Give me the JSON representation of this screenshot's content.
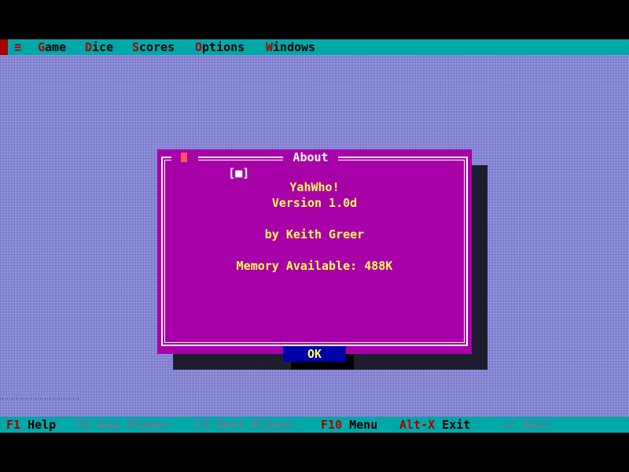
{
  "menubar": {
    "system_icon": "≡",
    "items": [
      {
        "hot": "G",
        "rest": "ame"
      },
      {
        "hot": "D",
        "rest": "ice"
      },
      {
        "hot": "S",
        "rest": "cores"
      },
      {
        "hot": "O",
        "rest": "ptions"
      },
      {
        "hot": "W",
        "rest": "indows"
      }
    ]
  },
  "dialog": {
    "title": "About",
    "close_box": "[■]",
    "app_name": "YahWho!",
    "version": "Version 1.0d",
    "author": "by Keith Greer",
    "memory": "Memory Available: 488K",
    "ok_label": "OK"
  },
  "statusbar": {
    "items": [
      {
        "key": "F1",
        "label": " Help",
        "enabled": true
      },
      {
        "key": "F2",
        "label": " New Player",
        "enabled": false
      },
      {
        "key": "F3",
        "label": " Next Player",
        "enabled": false
      },
      {
        "key": "F10",
        "label": " Menu",
        "enabled": true
      },
      {
        "key": "Alt-X",
        "label": " Exit",
        "enabled": true
      },
      {
        "key": "◄┘",
        "label": " Roll",
        "enabled": false
      }
    ]
  },
  "colors": {
    "menubar": "#00a8a8",
    "hotkey": "#a80000",
    "desktop": "#a8a8f0",
    "dialog": "#a800a8",
    "dialog_text": "#ffff55",
    "button": "#0000a8",
    "disabled": "#5a7f9a"
  }
}
